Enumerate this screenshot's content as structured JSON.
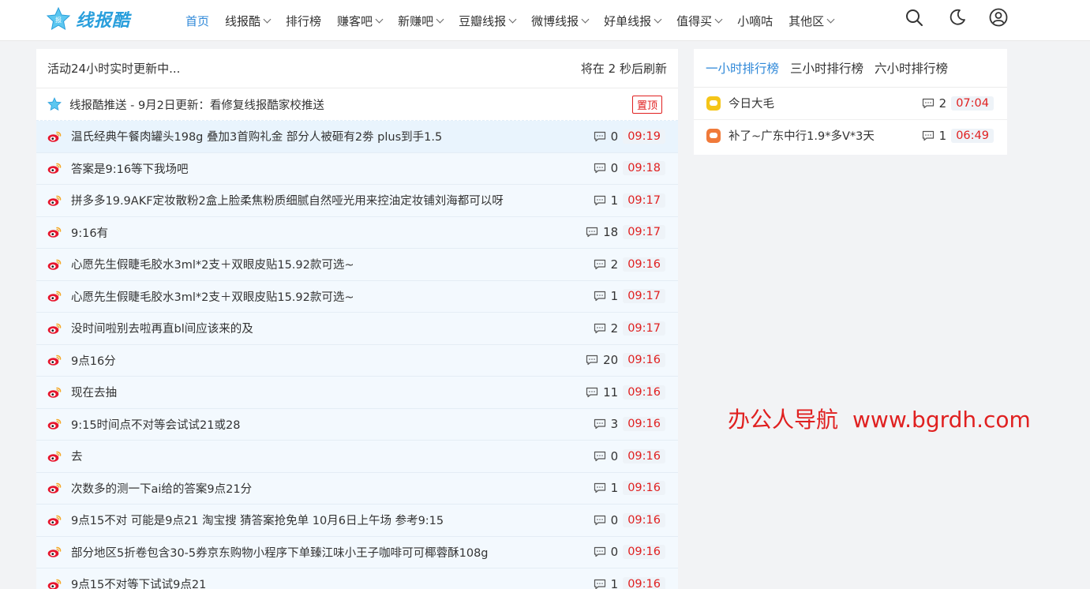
{
  "header": {
    "logo_text": "线报酷",
    "nav": [
      {
        "label": "首页",
        "dropdown": false,
        "active": true
      },
      {
        "label": "线报酷",
        "dropdown": true
      },
      {
        "label": "排行榜",
        "dropdown": false
      },
      {
        "label": "赚客吧",
        "dropdown": true
      },
      {
        "label": "新赚吧",
        "dropdown": true
      },
      {
        "label": "豆瓣线报",
        "dropdown": true
      },
      {
        "label": "微博线报",
        "dropdown": true
      },
      {
        "label": "好单线报",
        "dropdown": true
      },
      {
        "label": "值得买",
        "dropdown": true
      },
      {
        "label": "小嘀咕",
        "dropdown": false
      },
      {
        "label": "其他区",
        "dropdown": true
      }
    ],
    "icons": [
      "search-icon",
      "moon-icon",
      "user-icon"
    ]
  },
  "main": {
    "status_left": "活动24小时实时更新中...",
    "status_right": "将在 2 秒后刷新",
    "pinned": {
      "text": "线报酷推送 - 9月2日更新：看修复线报酷家校推送",
      "badge": "置顶"
    },
    "rows": [
      {
        "title": "温氏经典午餐肉罐头198g 叠加3首购礼金 部分人被砸有2劵 plus到手1.5",
        "comments": "0",
        "time": "09:19"
      },
      {
        "title": "答案是9:16等下我场吧",
        "comments": "0",
        "time": "09:18"
      },
      {
        "title": "拼多多19.9AKF定妆散粉2盒上脸柔焦粉质细腻自然哑光用来控油定妆铺刘海都可以呀",
        "comments": "1",
        "time": "09:17"
      },
      {
        "title": "9:16有",
        "comments": "18",
        "time": "09:17"
      },
      {
        "title": "心愿先生假睫毛胶水3ml*2支＋双眼皮贴15.92款可选~",
        "comments": "2",
        "time": "09:16"
      },
      {
        "title": "心愿先生假睫毛胶水3ml*2支＋双眼皮贴15.92款可选~",
        "comments": "1",
        "time": "09:17"
      },
      {
        "title": "没时间啦别去啦再直bl间应该来的及",
        "comments": "2",
        "time": "09:17"
      },
      {
        "title": "9点16分",
        "comments": "20",
        "time": "09:16"
      },
      {
        "title": "现在去抽",
        "comments": "11",
        "time": "09:16"
      },
      {
        "title": "9:15时间点不对等会试试21或28",
        "comments": "3",
        "time": "09:16"
      },
      {
        "title": "去",
        "comments": "0",
        "time": "09:16"
      },
      {
        "title": "次数多的测一下ai给的答案9点21分",
        "comments": "1",
        "time": "09:16"
      },
      {
        "title": "9点15不对 可能是9点21 淘宝搜 猜答案抢免单 10月6日上午场 参考9:15",
        "comments": "0",
        "time": "09:16"
      },
      {
        "title": "部分地区5折卷包含30-5券京东购物小程序下单臻江味小王子咖啡可可椰蓉酥108g",
        "comments": "0",
        "time": "09:16"
      },
      {
        "title": "9点15不对等下试试9点21",
        "comments": "1",
        "time": "09:16"
      }
    ]
  },
  "sidebar": {
    "tabs": [
      "一小时排行榜",
      "三小时排行榜",
      "六小时排行榜"
    ],
    "items": [
      {
        "title": "今日大毛",
        "comments": "2",
        "time": "07:04",
        "avatar_color": "#f5c518"
      },
      {
        "title": "补了~广东中行1.9*多V*3天",
        "comments": "1",
        "time": "06:49",
        "avatar_color": "#f07a3a"
      }
    ]
  },
  "watermark": {
    "cn": "办公人导航",
    "url": "www.bgrdh.com"
  },
  "colors": {
    "accent": "#2f88d8",
    "time_red": "#e02020",
    "row_bg": "#f3f9fe"
  }
}
